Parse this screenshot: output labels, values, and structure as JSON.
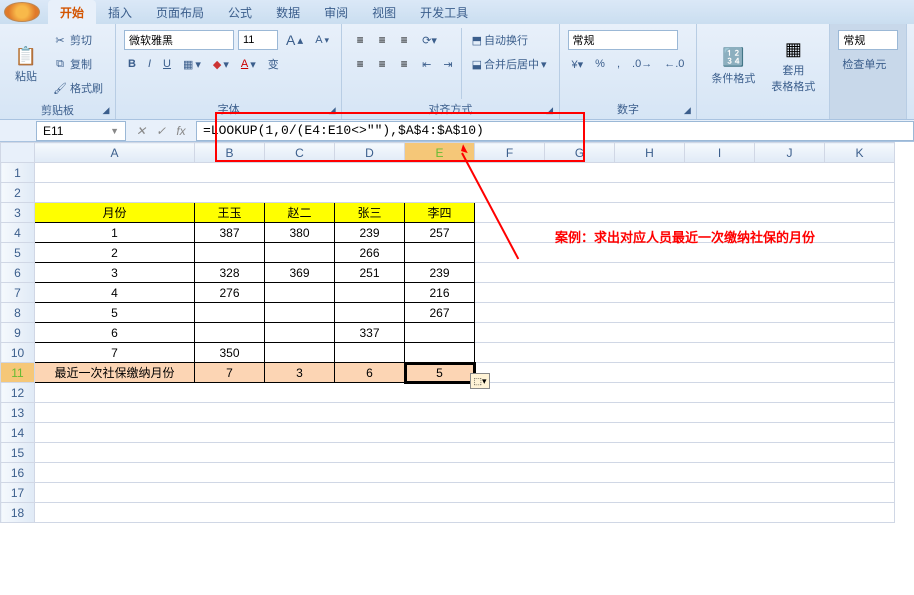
{
  "tabs": [
    "开始",
    "插入",
    "页面布局",
    "公式",
    "数据",
    "审阅",
    "视图",
    "开发工具"
  ],
  "active_tab": 0,
  "clipboard": {
    "paste": "粘贴",
    "cut": "剪切",
    "copy": "复制",
    "painter": "格式刷",
    "label": "剪贴板"
  },
  "font": {
    "name": "微软雅黑",
    "size": "11",
    "increase": "A",
    "decrease": "A",
    "bold": "B",
    "italic": "I",
    "underline": "U",
    "label": "字体",
    "wen": "变"
  },
  "align": {
    "wrap": "自动换行",
    "merge": "合并后居中",
    "label": "对齐方式"
  },
  "number": {
    "format": "常规",
    "label": "数字"
  },
  "styles": {
    "cond": "条件格式",
    "table": "套用\n表格格式",
    "label": ""
  },
  "cells": {
    "format": "常规",
    "check": "检查单元"
  },
  "namebox": "E11",
  "formula": "=LOOKUP(1,0/(E4:E10<>\"\"),$A$4:$A$10)",
  "columns": [
    "A",
    "B",
    "C",
    "D",
    "E",
    "F",
    "G",
    "H",
    "I",
    "J",
    "K"
  ],
  "table": {
    "header": [
      "月份",
      "王玉",
      "赵二",
      "张三",
      "李四"
    ],
    "rows": [
      [
        "1",
        "387",
        "380",
        "239",
        "257"
      ],
      [
        "2",
        "",
        "",
        "266",
        ""
      ],
      [
        "3",
        "328",
        "369",
        "251",
        "239"
      ],
      [
        "4",
        "276",
        "",
        "",
        "216"
      ],
      [
        "5",
        "",
        "",
        "",
        "267"
      ],
      [
        "6",
        "",
        "",
        "337",
        ""
      ],
      [
        "7",
        "350",
        "",
        "",
        ""
      ]
    ],
    "result": [
      "最近一次社保缴纳月份",
      "7",
      "3",
      "6",
      "5"
    ]
  },
  "annotation": "案例：求出对应人员最近一次缴纳社保的月份",
  "chart_data": {
    "type": "table",
    "title": "最近一次社保缴纳月份",
    "categories": [
      "王玉",
      "赵二",
      "张三",
      "李四"
    ],
    "values": [
      7,
      3,
      6,
      5
    ]
  }
}
